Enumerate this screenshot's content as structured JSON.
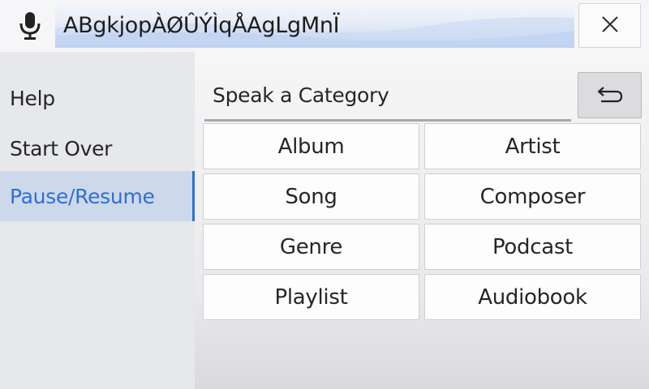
{
  "header": {
    "query_text": "ABgkjopÀØÛÝÌqÅAgLgMnÏ",
    "icons": {
      "mic": "microphone-icon",
      "close": "close-icon"
    }
  },
  "sidebar": {
    "items": [
      {
        "label": "Help"
      },
      {
        "label": "Start Over"
      },
      {
        "label": "Pause/Resume",
        "active": true
      }
    ]
  },
  "main": {
    "prompt_label": "Speak a Category",
    "back_icon": "back-arrow-icon",
    "categories": [
      "Album",
      "Artist",
      "Song",
      "Composer",
      "Genre",
      "Podcast",
      "Playlist",
      "Audiobook"
    ]
  },
  "colors": {
    "accent": "#2f6fd6",
    "active_bg": "#cdd9ea"
  }
}
